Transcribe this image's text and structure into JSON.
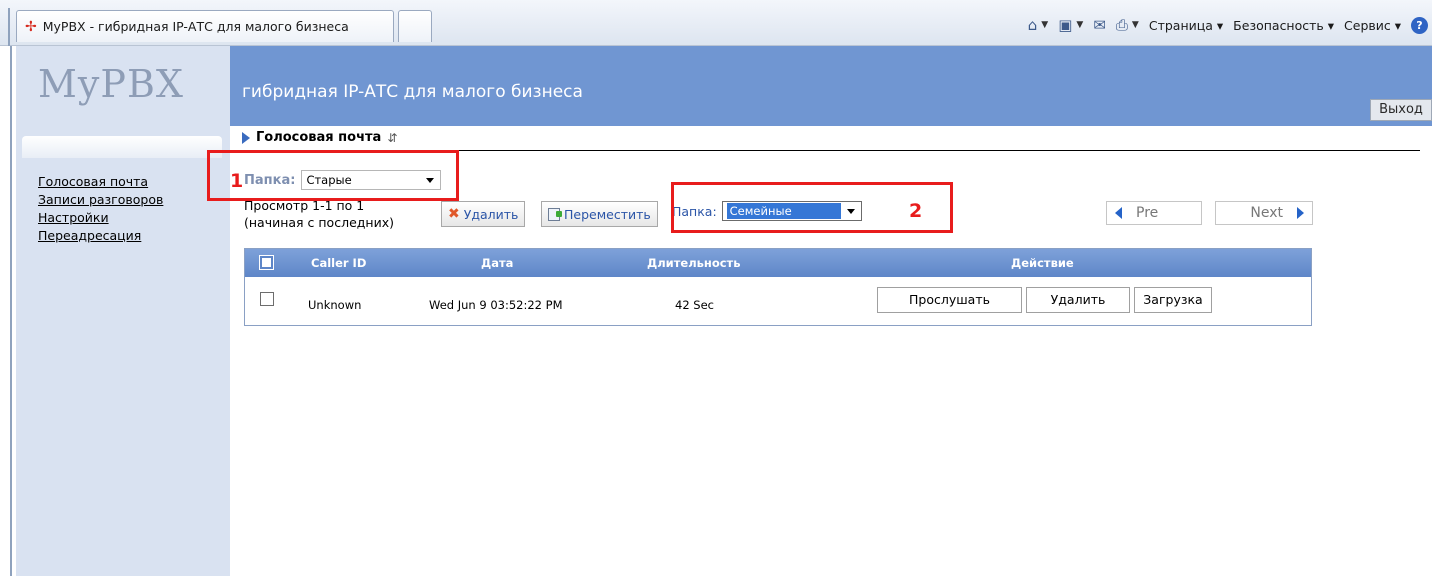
{
  "browser": {
    "tab_title": "MyPBX - гибридная IP-АТС для малого бизнеса",
    "commands": {
      "page": "Страница",
      "security": "Безопасность",
      "service": "Сервис"
    }
  },
  "header": {
    "logo": "MyPBX",
    "subtitle": "гибридная IP-АТС для малого бизнеса",
    "logout": "Выход"
  },
  "sidebar": {
    "items": [
      {
        "label": "Голосовая почта"
      },
      {
        "label": "Записи разговоров"
      },
      {
        "label": "Настройки"
      },
      {
        "label": "Переадресация"
      }
    ]
  },
  "main": {
    "section_title": "Голосовая почта",
    "folder_label": "Папка:",
    "folder_value": "Старые",
    "view_info_line1": "Просмотр 1-1 по 1",
    "view_info_line2": "(начиная с последних)",
    "delete_label": "Удалить",
    "move_label": "Переместить",
    "move_folder_label": "Папка:",
    "move_folder_value": "Семейные",
    "pager": {
      "prev": "Pre",
      "next": "Next"
    }
  },
  "table": {
    "columns": [
      "Caller ID",
      "Дата",
      "Длительность",
      "Действие"
    ],
    "rows": [
      {
        "caller_id": "Unknown",
        "date": "Wed Jun 9 03:52:22 PM",
        "duration": "42 Sec",
        "actions": {
          "listen": "Прослушать",
          "delete": "Удалить",
          "download": "Загрузка"
        }
      }
    ]
  },
  "annotations": {
    "first": "1",
    "second": "2"
  },
  "colors": {
    "banner": "#7096d2",
    "sidebar": "#d9e2f1",
    "table_header": "#6a90cf",
    "annotation": "#e81c1c"
  }
}
